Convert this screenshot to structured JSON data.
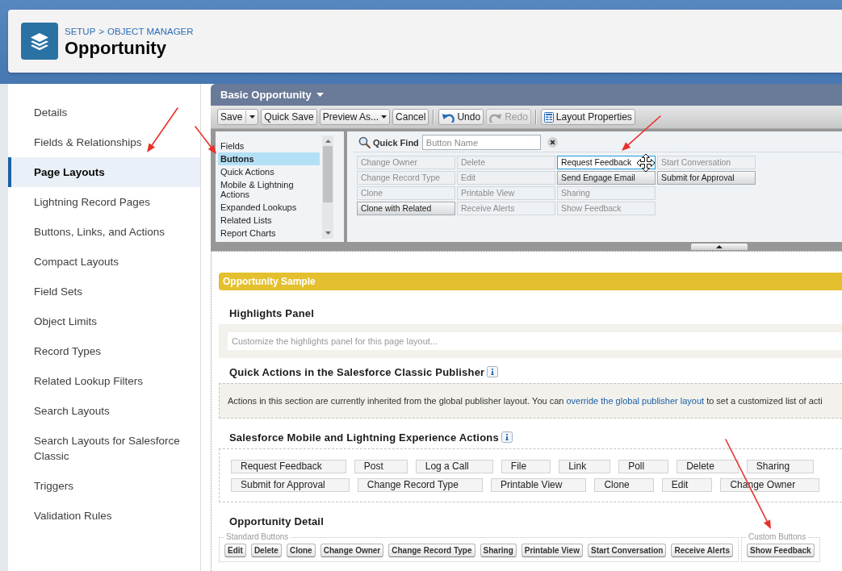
{
  "header": {
    "breadcrumb": {
      "items": [
        "SETUP",
        "OBJECT MANAGER"
      ],
      "separator": ">"
    },
    "title": "Opportunity"
  },
  "sidebar": {
    "items": [
      {
        "label": "Details",
        "selected": false
      },
      {
        "label": "Fields & Relationships",
        "selected": false
      },
      {
        "label": "Page Layouts",
        "selected": true
      },
      {
        "label": "Lightning Record Pages",
        "selected": false
      },
      {
        "label": "Buttons, Links, and Actions",
        "selected": false
      },
      {
        "label": "Compact Layouts",
        "selected": false
      },
      {
        "label": "Field Sets",
        "selected": false
      },
      {
        "label": "Object Limits",
        "selected": false
      },
      {
        "label": "Record Types",
        "selected": false
      },
      {
        "label": "Related Lookup Filters",
        "selected": false
      },
      {
        "label": "Search Layouts",
        "selected": false
      },
      {
        "label": "Search Layouts for Salesforce Classic",
        "selected": false
      },
      {
        "label": "Triggers",
        "selected": false
      },
      {
        "label": "Validation Rules",
        "selected": false
      }
    ]
  },
  "layout_editor": {
    "layout_name": "Basic Opportunity",
    "toolbar": [
      {
        "buttons": [
          {
            "label": "Save",
            "kind": "split",
            "disabled": false
          },
          {
            "label": "Quick Save",
            "kind": "plain",
            "disabled": false
          },
          {
            "label": "Preview As...",
            "kind": "dropdown",
            "disabled": false
          },
          {
            "label": "Cancel",
            "kind": "plain",
            "disabled": false
          }
        ]
      },
      {
        "buttons": [
          {
            "label": "Undo",
            "kind": "undo",
            "disabled": false
          },
          {
            "label": "Redo",
            "kind": "redo",
            "disabled": true
          }
        ]
      },
      {
        "buttons": [
          {
            "label": "Layout Properties",
            "kind": "properties",
            "disabled": false
          }
        ]
      }
    ],
    "palette": {
      "categories": [
        {
          "label": "Fields",
          "selected": false
        },
        {
          "label": "Buttons",
          "selected": true
        },
        {
          "label": "Quick Actions",
          "selected": false
        },
        {
          "label": "Mobile & Lightning Actions",
          "selected": false
        },
        {
          "label": "Expanded Lookups",
          "selected": false
        },
        {
          "label": "Related Lists",
          "selected": false
        },
        {
          "label": "Report Charts",
          "selected": false
        }
      ],
      "quick_find": {
        "label": "Quick Find",
        "placeholder": "Button Name"
      },
      "items": [
        {
          "label": "Change Owner",
          "in_layout": true,
          "selected": false
        },
        {
          "label": "Change Record Type",
          "in_layout": true,
          "selected": false
        },
        {
          "label": "Clone",
          "in_layout": true,
          "selected": false
        },
        {
          "label": "Clone with Related",
          "in_layout": false,
          "selected": false
        },
        {
          "label": "Delete",
          "in_layout": true,
          "selected": false
        },
        {
          "label": "Edit",
          "in_layout": true,
          "selected": false
        },
        {
          "label": "Printable View",
          "in_layout": true,
          "selected": false
        },
        {
          "label": "Receive Alerts",
          "in_layout": true,
          "selected": false
        },
        {
          "label": "Request Feedback",
          "in_layout": false,
          "selected": true
        },
        {
          "label": "Send Engage Email",
          "in_layout": false,
          "selected": false
        },
        {
          "label": "Sharing",
          "in_layout": true,
          "selected": false
        },
        {
          "label": "Show Feedback",
          "in_layout": true,
          "selected": false
        },
        {
          "label": "Start Conversation",
          "in_layout": true,
          "selected": false
        },
        {
          "label": "Submit for Approval",
          "in_layout": false,
          "selected": false
        }
      ]
    },
    "layout": {
      "title": "Opportunity Sample",
      "sections": [
        {
          "kind": "highlights",
          "title": "Highlights Panel",
          "info": false,
          "hint": "Customize the highlights panel for this page layout..."
        },
        {
          "kind": "publisher",
          "title": "Quick Actions in the Salesforce Classic Publisher",
          "info": true,
          "text_before": "Actions in this section are currently inherited from the global publisher layout. You can",
          "link": "override the global publisher layout",
          "text_after": "to set a customized list of acti"
        },
        {
          "kind": "actions",
          "title": "Salesforce Mobile and Lightning Experience Actions",
          "info": true,
          "actions": [
            "Request Feedback",
            "Post",
            "Log a Call",
            "File",
            "Link",
            "Poll",
            "Delete",
            "Sharing",
            "Submit for Approval",
            "Change Record Type",
            "Printable View",
            "Clone",
            "Edit",
            "Change Owner"
          ]
        },
        {
          "kind": "buttons",
          "title": "Opportunity Detail",
          "info": false,
          "groups": [
            {
              "legend": "Standard Buttons",
              "buttons": [
                "Edit",
                "Delete",
                "Clone",
                "Change Owner",
                "Change Record Type",
                "Sharing",
                "Printable View",
                "Start Conversation",
                "Receive Alerts"
              ]
            },
            {
              "legend": "Custom Buttons",
              "buttons": [
                "Show Feedback"
              ]
            }
          ]
        }
      ]
    }
  }
}
